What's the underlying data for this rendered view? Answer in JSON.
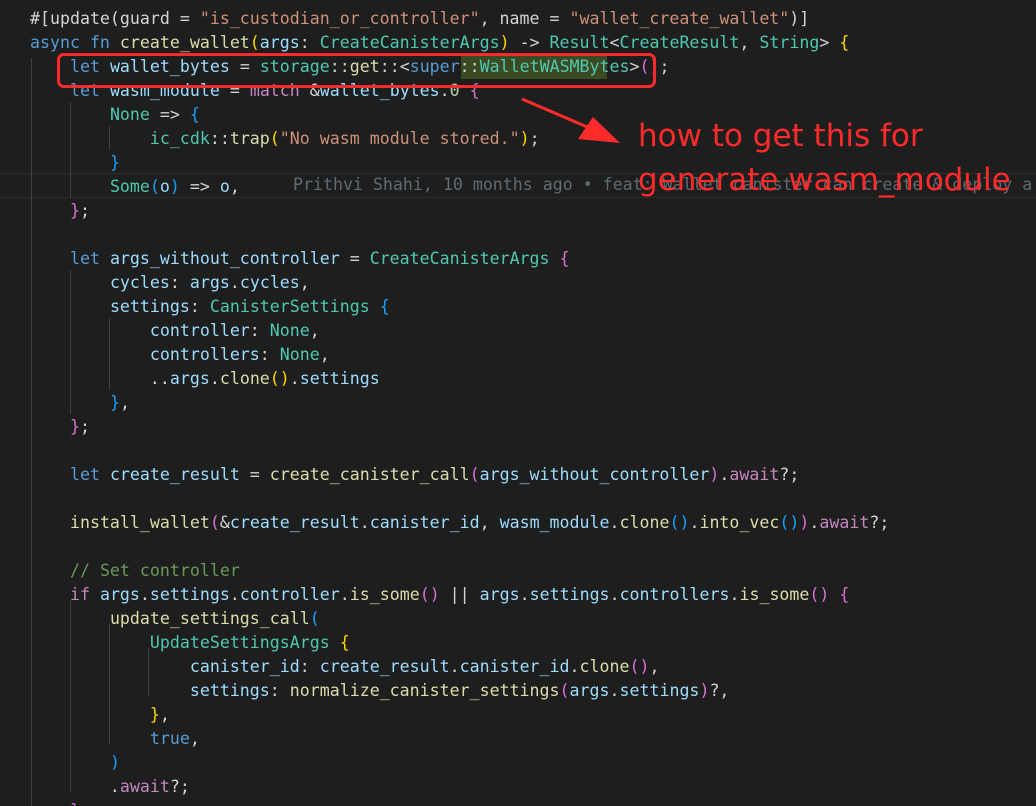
{
  "colors": {
    "background": "#1e1e1e",
    "annotation": "#ff2a2a",
    "indent_guide": "#404040"
  },
  "code_lines": [
    [
      {
        "t": "#[update(guard = ",
        "c": "pl"
      },
      {
        "t": "\"is_custodian_or_controller\"",
        "c": "str"
      },
      {
        "t": ", name = ",
        "c": "pl"
      },
      {
        "t": "\"wallet_create_wallet\"",
        "c": "str"
      },
      {
        "t": ")]",
        "c": "pl"
      }
    ],
    [
      {
        "t": "async fn ",
        "c": "kw"
      },
      {
        "t": "create_wallet",
        "c": "fn"
      },
      {
        "t": "(",
        "c": "br1"
      },
      {
        "t": "args",
        "c": "var"
      },
      {
        "t": ": ",
        "c": "pl"
      },
      {
        "t": "CreateCanisterArgs",
        "c": "ty"
      },
      {
        "t": ")",
        "c": "br1"
      },
      {
        "t": " -> ",
        "c": "pl"
      },
      {
        "t": "Result",
        "c": "ty"
      },
      {
        "t": "<",
        "c": "pl"
      },
      {
        "t": "CreateResult",
        "c": "ty"
      },
      {
        "t": ", ",
        "c": "pl"
      },
      {
        "t": "String",
        "c": "ty"
      },
      {
        "t": "> ",
        "c": "pl"
      },
      {
        "t": "{",
        "c": "br1"
      }
    ],
    [
      {
        "t": "    ",
        "c": "pl"
      },
      {
        "t": "let ",
        "c": "kw"
      },
      {
        "t": "wallet_bytes",
        "c": "var"
      },
      {
        "t": " = ",
        "c": "pl"
      },
      {
        "t": "storage",
        "c": "ty"
      },
      {
        "t": "::",
        "c": "pl"
      },
      {
        "t": "get",
        "c": "fn"
      },
      {
        "t": "::<",
        "c": "pl"
      },
      {
        "t": "super",
        "c": "kw"
      },
      {
        "t": "::",
        "c": "pl"
      },
      {
        "t": "WalletWASMBytes",
        "c": "ty"
      },
      {
        "t": ">",
        "c": "pl"
      },
      {
        "t": "()",
        "c": "br2"
      },
      {
        "t": ";",
        "c": "pl"
      }
    ],
    [
      {
        "t": "    ",
        "c": "pl"
      },
      {
        "t": "let ",
        "c": "kw"
      },
      {
        "t": "wasm_module",
        "c": "var"
      },
      {
        "t": " = ",
        "c": "pl"
      },
      {
        "t": "match ",
        "c": "ctl"
      },
      {
        "t": "&",
        "c": "pl"
      },
      {
        "t": "wallet_bytes",
        "c": "var"
      },
      {
        "t": ".",
        "c": "pl"
      },
      {
        "t": "0",
        "c": "num"
      },
      {
        "t": " ",
        "c": "pl"
      },
      {
        "t": "{",
        "c": "br2"
      }
    ],
    [
      {
        "t": "        ",
        "c": "pl"
      },
      {
        "t": "None",
        "c": "ty"
      },
      {
        "t": " => ",
        "c": "pl"
      },
      {
        "t": "{",
        "c": "br3"
      }
    ],
    [
      {
        "t": "            ",
        "c": "pl"
      },
      {
        "t": "ic_cdk",
        "c": "ty"
      },
      {
        "t": "::",
        "c": "pl"
      },
      {
        "t": "trap",
        "c": "fn"
      },
      {
        "t": "(",
        "c": "br1"
      },
      {
        "t": "\"No wasm module stored.\"",
        "c": "str"
      },
      {
        "t": ")",
        "c": "br1"
      },
      {
        "t": ";",
        "c": "pl"
      }
    ],
    [
      {
        "t": "        ",
        "c": "pl"
      },
      {
        "t": "}",
        "c": "br3"
      }
    ],
    [
      {
        "t": "        ",
        "c": "pl"
      },
      {
        "t": "Some",
        "c": "ty"
      },
      {
        "t": "(",
        "c": "br3"
      },
      {
        "t": "o",
        "c": "var"
      },
      {
        "t": ")",
        "c": "br3"
      },
      {
        "t": " => ",
        "c": "pl"
      },
      {
        "t": "o",
        "c": "var"
      },
      {
        "t": ",",
        "c": "pl"
      }
    ],
    [
      {
        "t": "    ",
        "c": "pl"
      },
      {
        "t": "}",
        "c": "br2"
      },
      {
        "t": ";",
        "c": "pl"
      }
    ],
    [],
    [
      {
        "t": "    ",
        "c": "pl"
      },
      {
        "t": "let ",
        "c": "kw"
      },
      {
        "t": "args_without_controller",
        "c": "var"
      },
      {
        "t": " = ",
        "c": "pl"
      },
      {
        "t": "CreateCanisterArgs",
        "c": "ty"
      },
      {
        "t": " ",
        "c": "pl"
      },
      {
        "t": "{",
        "c": "br2"
      }
    ],
    [
      {
        "t": "        ",
        "c": "pl"
      },
      {
        "t": "cycles",
        "c": "var"
      },
      {
        "t": ": ",
        "c": "pl"
      },
      {
        "t": "args",
        "c": "var"
      },
      {
        "t": ".",
        "c": "pl"
      },
      {
        "t": "cycles",
        "c": "var"
      },
      {
        "t": ",",
        "c": "pl"
      }
    ],
    [
      {
        "t": "        ",
        "c": "pl"
      },
      {
        "t": "settings",
        "c": "var"
      },
      {
        "t": ": ",
        "c": "pl"
      },
      {
        "t": "CanisterSettings",
        "c": "ty"
      },
      {
        "t": " ",
        "c": "pl"
      },
      {
        "t": "{",
        "c": "br3"
      }
    ],
    [
      {
        "t": "            ",
        "c": "pl"
      },
      {
        "t": "controller",
        "c": "var"
      },
      {
        "t": ": ",
        "c": "pl"
      },
      {
        "t": "None",
        "c": "ty"
      },
      {
        "t": ",",
        "c": "pl"
      }
    ],
    [
      {
        "t": "            ",
        "c": "pl"
      },
      {
        "t": "controllers",
        "c": "var"
      },
      {
        "t": ": ",
        "c": "pl"
      },
      {
        "t": "None",
        "c": "ty"
      },
      {
        "t": ",",
        "c": "pl"
      }
    ],
    [
      {
        "t": "            ..",
        "c": "pl"
      },
      {
        "t": "args",
        "c": "var"
      },
      {
        "t": ".",
        "c": "pl"
      },
      {
        "t": "clone",
        "c": "fn"
      },
      {
        "t": "()",
        "c": "br1"
      },
      {
        "t": ".",
        "c": "pl"
      },
      {
        "t": "settings",
        "c": "var"
      }
    ],
    [
      {
        "t": "        ",
        "c": "pl"
      },
      {
        "t": "}",
        "c": "br3"
      },
      {
        "t": ",",
        "c": "pl"
      }
    ],
    [
      {
        "t": "    ",
        "c": "pl"
      },
      {
        "t": "}",
        "c": "br2"
      },
      {
        "t": ";",
        "c": "pl"
      }
    ],
    [],
    [
      {
        "t": "    ",
        "c": "pl"
      },
      {
        "t": "let ",
        "c": "kw"
      },
      {
        "t": "create_result",
        "c": "var"
      },
      {
        "t": " = ",
        "c": "pl"
      },
      {
        "t": "create_canister_call",
        "c": "fn"
      },
      {
        "t": "(",
        "c": "br2"
      },
      {
        "t": "args_without_controller",
        "c": "var"
      },
      {
        "t": ")",
        "c": "br2"
      },
      {
        "t": ".",
        "c": "pl"
      },
      {
        "t": "await",
        "c": "ctl"
      },
      {
        "t": "?;",
        "c": "pl"
      }
    ],
    [],
    [
      {
        "t": "    ",
        "c": "pl"
      },
      {
        "t": "install_wallet",
        "c": "fn"
      },
      {
        "t": "(",
        "c": "br2"
      },
      {
        "t": "&",
        "c": "pl"
      },
      {
        "t": "create_result",
        "c": "var"
      },
      {
        "t": ".",
        "c": "pl"
      },
      {
        "t": "canister_id",
        "c": "var"
      },
      {
        "t": ", ",
        "c": "pl"
      },
      {
        "t": "wasm_module",
        "c": "var"
      },
      {
        "t": ".",
        "c": "pl"
      },
      {
        "t": "clone",
        "c": "fn"
      },
      {
        "t": "()",
        "c": "br3"
      },
      {
        "t": ".",
        "c": "pl"
      },
      {
        "t": "into_vec",
        "c": "fn"
      },
      {
        "t": "()",
        "c": "br3"
      },
      {
        "t": ")",
        "c": "br2"
      },
      {
        "t": ".",
        "c": "pl"
      },
      {
        "t": "await",
        "c": "ctl"
      },
      {
        "t": "?;",
        "c": "pl"
      }
    ],
    [],
    [
      {
        "t": "    ",
        "c": "pl"
      },
      {
        "t": "// Set controller",
        "c": "cmt"
      }
    ],
    [
      {
        "t": "    ",
        "c": "pl"
      },
      {
        "t": "if ",
        "c": "ctl"
      },
      {
        "t": "args",
        "c": "var"
      },
      {
        "t": ".",
        "c": "pl"
      },
      {
        "t": "settings",
        "c": "var"
      },
      {
        "t": ".",
        "c": "pl"
      },
      {
        "t": "controller",
        "c": "var"
      },
      {
        "t": ".",
        "c": "pl"
      },
      {
        "t": "is_some",
        "c": "fn"
      },
      {
        "t": "()",
        "c": "br2"
      },
      {
        "t": " || ",
        "c": "pl"
      },
      {
        "t": "args",
        "c": "var"
      },
      {
        "t": ".",
        "c": "pl"
      },
      {
        "t": "settings",
        "c": "var"
      },
      {
        "t": ".",
        "c": "pl"
      },
      {
        "t": "controllers",
        "c": "var"
      },
      {
        "t": ".",
        "c": "pl"
      },
      {
        "t": "is_some",
        "c": "fn"
      },
      {
        "t": "()",
        "c": "br2"
      },
      {
        "t": " ",
        "c": "pl"
      },
      {
        "t": "{",
        "c": "br2"
      }
    ],
    [
      {
        "t": "        ",
        "c": "pl"
      },
      {
        "t": "update_settings_call",
        "c": "fn"
      },
      {
        "t": "(",
        "c": "br3"
      }
    ],
    [
      {
        "t": "            ",
        "c": "pl"
      },
      {
        "t": "UpdateSettingsArgs",
        "c": "ty"
      },
      {
        "t": " ",
        "c": "pl"
      },
      {
        "t": "{",
        "c": "br1"
      }
    ],
    [
      {
        "t": "                ",
        "c": "pl"
      },
      {
        "t": "canister_id",
        "c": "var"
      },
      {
        "t": ": ",
        "c": "pl"
      },
      {
        "t": "create_result",
        "c": "var"
      },
      {
        "t": ".",
        "c": "pl"
      },
      {
        "t": "canister_id",
        "c": "var"
      },
      {
        "t": ".",
        "c": "pl"
      },
      {
        "t": "clone",
        "c": "fn"
      },
      {
        "t": "()",
        "c": "br2"
      },
      {
        "t": ",",
        "c": "pl"
      }
    ],
    [
      {
        "t": "                ",
        "c": "pl"
      },
      {
        "t": "settings",
        "c": "var"
      },
      {
        "t": ": ",
        "c": "pl"
      },
      {
        "t": "normalize_canister_settings",
        "c": "fn"
      },
      {
        "t": "(",
        "c": "br2"
      },
      {
        "t": "args",
        "c": "var"
      },
      {
        "t": ".",
        "c": "pl"
      },
      {
        "t": "settings",
        "c": "var"
      },
      {
        "t": ")",
        "c": "br2"
      },
      {
        "t": "?,",
        "c": "pl"
      }
    ],
    [
      {
        "t": "            ",
        "c": "pl"
      },
      {
        "t": "}",
        "c": "br1"
      },
      {
        "t": ",",
        "c": "pl"
      }
    ],
    [
      {
        "t": "            ",
        "c": "pl"
      },
      {
        "t": "true",
        "c": "kw"
      },
      {
        "t": ",",
        "c": "pl"
      }
    ],
    [
      {
        "t": "        ",
        "c": "pl"
      },
      {
        "t": ")",
        "c": "br3"
      }
    ],
    [
      {
        "t": "        .",
        "c": "pl"
      },
      {
        "t": "await",
        "c": "ctl"
      },
      {
        "t": "?;",
        "c": "pl"
      }
    ],
    [
      {
        "t": "    ",
        "c": "pl"
      },
      {
        "t": "}",
        "c": "br2"
      }
    ]
  ],
  "blame": "Prithvi Shahi, 10 months ago • feat: Wallet canister can create & deploy a",
  "annotation": {
    "line1": "how to get this for",
    "line2": "generate wasm_module"
  }
}
